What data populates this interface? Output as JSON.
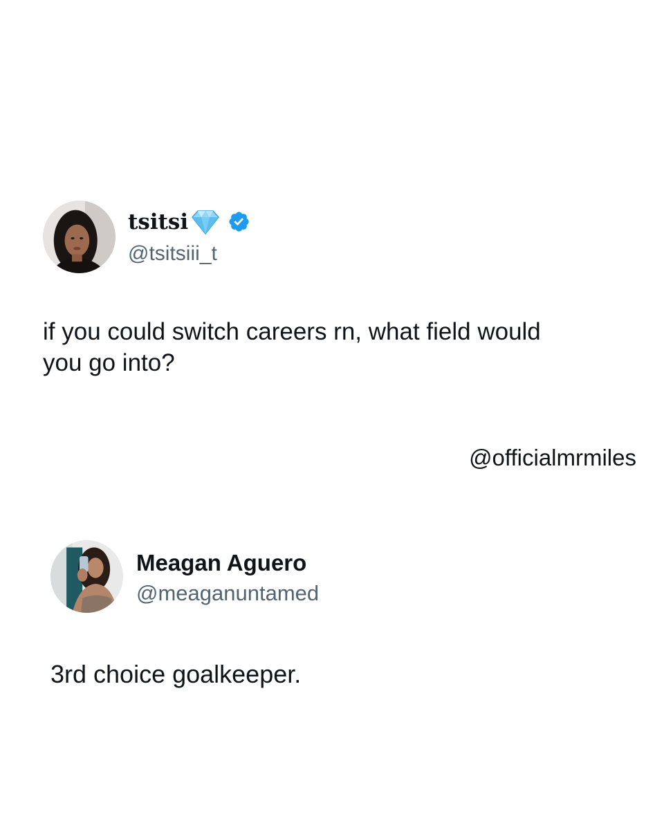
{
  "original_tweet": {
    "display_name": "tsitsi",
    "handle": "@tsitsiii_t",
    "name_emoji": "diamond-icon",
    "verified": true,
    "verified_icon": "verified-badge-icon",
    "text": "if you could switch careers rn, what field would you go into?"
  },
  "watermark": {
    "text": "@officialmrmiles"
  },
  "reply_tweet": {
    "display_name": "Meagan Aguero",
    "handle": "@meaganuntamed",
    "text": "3rd choice goalkeeper."
  },
  "colors": {
    "background": "#ffffff",
    "text": "#0f1419",
    "handle": "#536471",
    "verified_blue": "#1d9bf0",
    "diamond": "#6ec6f2"
  }
}
